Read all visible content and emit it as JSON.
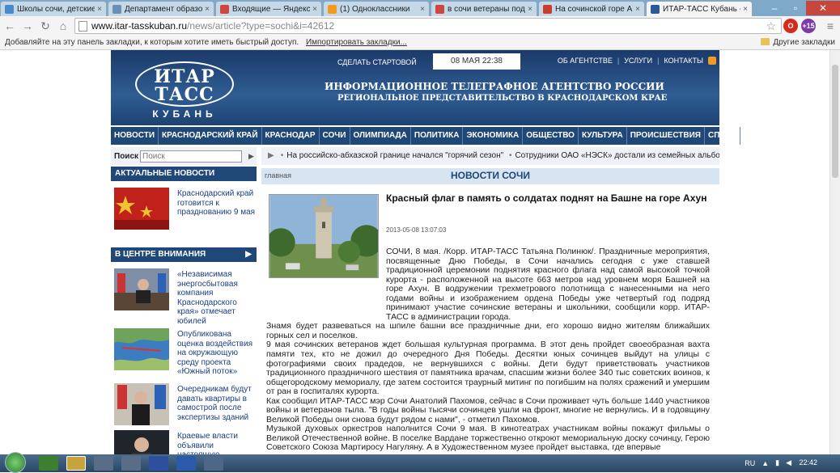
{
  "browser": {
    "tabs": [
      {
        "label": "Школы сочи, детские",
        "fav_color": "#4a8acb"
      },
      {
        "label": "Департамент образов",
        "fav_color": "#6c8fb5"
      },
      {
        "label": "Входящие — Яндекс.",
        "fav_color": "#d0463e"
      },
      {
        "label": "(1) Одноклассники",
        "fav_color": "#f39a1e"
      },
      {
        "label": "в сочи ветераны под",
        "fav_color": "#d0463e"
      },
      {
        "label": "На сочинской горе А",
        "fav_color": "#cc3b2b"
      },
      {
        "label": "ИТАР-ТАСС Кубань -",
        "fav_color": "#2a5a9a"
      }
    ],
    "url_host": "www.itar-tasskuban.ru",
    "url_path": "/news/article?type=sochi&i=42612",
    "bookmarks_prompt": "Добавляйте на эту панель закладки, к которым хотите иметь быстрый доступ.",
    "bookmarks_import": "Импортировать закладки...",
    "other_bookmarks": "Другие закладки",
    "ext_badge": "+15"
  },
  "site": {
    "logo": {
      "line1": "ИТАР",
      "line2": "ТАСС",
      "line3": "КУБАНЬ"
    },
    "make_start": "СДЕЛАТЬ СТАРТОВОЙ",
    "date": "08 МАЯ 22:38",
    "top_links": [
      "ОБ АГЕНТСТВЕ",
      "УСЛУГИ",
      "КОНТАКТЫ"
    ],
    "title1": "ИНФОРМАЦИОННОЕ ТЕЛЕГРАФНОЕ АГЕНТСТВО РОССИИ",
    "title2": "РЕГИОНАЛЬНОЕ ПРЕДСТАВИТЕЛЬСТВО В КРАСНОДАРСКОМ КРАЕ",
    "menu": [
      "НОВОСТИ",
      "КРАСНОДАРСКИЙ КРАЙ",
      "КРАСНОДАР",
      "СОЧИ",
      "ОЛИМПИАДА",
      "ПОЛИТИКА",
      "ЭКОНОМИКА",
      "ОБЩЕСТВО",
      "КУЛЬТУРА",
      "ПРОИСШЕСТВИЯ",
      "СПОРТ",
      "ФОТО"
    ],
    "search_label": "Поиск",
    "search_placeholder": "Поиск",
    "ticker": [
      "На российско-абхазской границе начался \"горячий сезон\"",
      "Сотрудники ОАО «НЭСК» достали из семейных альбомов с"
    ],
    "actual_title": "АКТУАЛЬНЫЕ НОВОСТИ",
    "actual_item": "Краснодарский край готовится к празднованию 9 мая",
    "focus_title": "В ЦЕНТРЕ ВНИМАНИЯ",
    "focus_items": [
      "«Независимая энергосбытовая компания Краснодарского края» отмечает юбилей",
      "Опубликована оценка воздействия на окружающую среду проекта «Южный поток»",
      "Очередникам будут давать квартиры в самострой после экспертизы зданий",
      "Краевые власти объявили настоящую"
    ],
    "crumb_home": "главная",
    "section_title": "НОВОСТИ СОЧИ",
    "article": {
      "title": "Красный флаг в память о солдатах поднят на Башне на горе Ахун",
      "date": "2013-05-08 13:07:03",
      "paragraphs": [
        "СОЧИ, 8 мая. /Корр. ИТАР-ТАСС Татьяна Полинюк/. Праздничные мероприятия, посвященные Дню Победы, в Сочи начались сегодня с уже ставшей традиционной церемонии поднятия красного флага над самой высокой точкой курорта - расположенной на высоте 663 метров над уровнем моря Башней на горе Ахун. В водружении трехметрового полотнища с нанесенными на него годами войны и изображением ордена Победы уже четвертый год подряд принимают участие сочинские ветераны и школьники, сообщили корр. ИТАР-ТАСС в администрации города.",
        "Знамя будет развеваться на шпиле башни все праздничные дни, его хорошо видно жителям ближайших горных сел и поселков.",
        "9 мая сочинских ветеранов ждет большая культурная программа. В этот день пройдет своеобразная вахта памяти тех, кто не дожил до очередного Дня Победы. Десятки юных сочинцев выйдут на улицы с фотографиями своих прадедов, не вернувшихся с войны. Дети будут приветствовать участников традиционного праздничного шествия от памятника врачам, спасшим жизни более 340 тыс советских воинов, к общегородскому мемориалу, где затем состоится траурный митинг по погибшим на полях сражений и умершим от ран в госпиталях курорта.",
        "Как сообщил ИТАР-ТАСС мэр Сочи Анатолий Пахомов, сейчас в Сочи проживает чуть больше 1440 участников войны и ветеранов тыла. \"В годы войны тысячи сочинцев ушли на фронт, многие не вернулись. И в годовщину Великой Победы они снова будут рядом с нами\", - отметил Пахомов.",
        "Музыкой духовых оркестров наполнится Сочи 9 мая. В кинотеатрах участникам войны покажут фильмы о Великой Отечественной войне. В поселке Вардане торжественно откроют мемориальную доску сочинцу, Герою Советского Союза Мартиросу Нагуляну. А в Художественном музее пройдет выставка, где впервые"
      ]
    }
  },
  "taskbar": {
    "lang": "RU",
    "time": "22:42"
  }
}
